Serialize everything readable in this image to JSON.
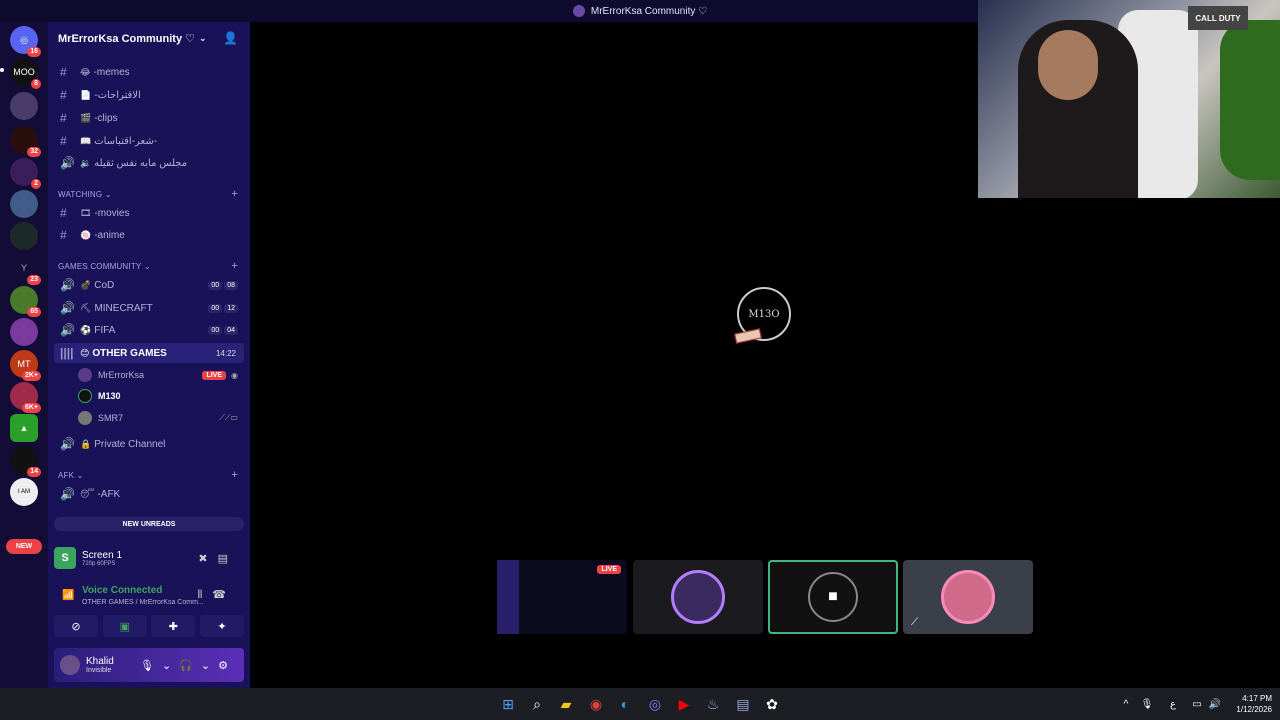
{
  "window": {
    "title": "MrErrorKsa Community ♡"
  },
  "rail": {
    "servers": [
      {
        "label": "",
        "badge": "16"
      },
      {
        "label": "MOO",
        "badge": "8"
      },
      {
        "label": "",
        "badge": ""
      },
      {
        "label": "",
        "badge": "32"
      },
      {
        "label": "",
        "badge": "2"
      },
      {
        "label": "",
        "badge": ""
      },
      {
        "label": "",
        "badge": ""
      },
      {
        "label": "",
        "badge": "23"
      },
      {
        "label": "",
        "badge": "65"
      },
      {
        "label": "",
        "badge": ""
      },
      {
        "label": "MT",
        "badge": "2K+"
      },
      {
        "label": "",
        "badge": "6K+"
      },
      {
        "label": "",
        "badge": ""
      },
      {
        "label": "",
        "badge": "14"
      },
      {
        "label": "",
        "badge": ""
      }
    ],
    "new_label": "NEW"
  },
  "sidebar": {
    "server_name": "MrErrorKsa Community ♡",
    "channels": [
      {
        "sym": "#",
        "emoji": "😂",
        "name": "-memes"
      },
      {
        "sym": "#",
        "emoji": "📄",
        "name": "-الاقتراحات"
      },
      {
        "sym": "#",
        "emoji": "🎬",
        "name": "-clips"
      },
      {
        "sym": "#",
        "emoji": "📖",
        "name": "شعر-اقتباسات-"
      },
      {
        "sym": "🔊",
        "emoji": "🔉",
        "name": "مجلس مابه نفس ثقيله"
      }
    ],
    "cat_watching": "WATCHING",
    "watching": [
      {
        "sym": "#",
        "emoji": "🎞",
        "name": "-movies"
      },
      {
        "sym": "#",
        "emoji": "🍥",
        "name": "-anime"
      }
    ],
    "cat_games": "GAMES COMMUNITY",
    "games": [
      {
        "emoji": "💣",
        "name": "CoD",
        "c1": "00",
        "c2": "08"
      },
      {
        "emoji": "⛏",
        "name": "MINECRAFT",
        "c1": "00",
        "c2": "12"
      },
      {
        "emoji": "⚽",
        "name": "FIFA",
        "c1": "00",
        "c2": "04"
      }
    ],
    "active_channel": {
      "emoji": "😊",
      "name": "OTHER GAMES",
      "timer": "14:22"
    },
    "voice_users": [
      {
        "name": "MrErrorKsa",
        "live": "LIVE"
      },
      {
        "name": "M130"
      },
      {
        "name": "SMR7"
      }
    ],
    "private_channel": {
      "emoji": "🔒",
      "name": "Private Channel"
    },
    "cat_afk": "AFK",
    "afk_channel": {
      "emoji": "😴",
      "name": "-AFK"
    },
    "new_unreads": "NEW UNREADS"
  },
  "screen_panel": {
    "title": "Screen 1",
    "quality": "720p 60FPS"
  },
  "voice_panel": {
    "status": "Voice Connected",
    "location": "OTHER GAMES / MrErrorKsa Comm..."
  },
  "user_panel": {
    "name": "Khalid",
    "status": "Invisible"
  },
  "stage": {
    "speaker_name": "M13O",
    "tiles": [
      {
        "live": "LIVE"
      }
    ]
  },
  "webcam": {
    "poster_text": "CALL DUTY"
  },
  "taskbar": {
    "time": "4:17 PM",
    "date": "1/12/2026",
    "lang": "ع"
  },
  "colors": {
    "accent_green": "#3ba55d",
    "live_red": "#ed4245",
    "sidebar_bg": "#1a1258"
  }
}
